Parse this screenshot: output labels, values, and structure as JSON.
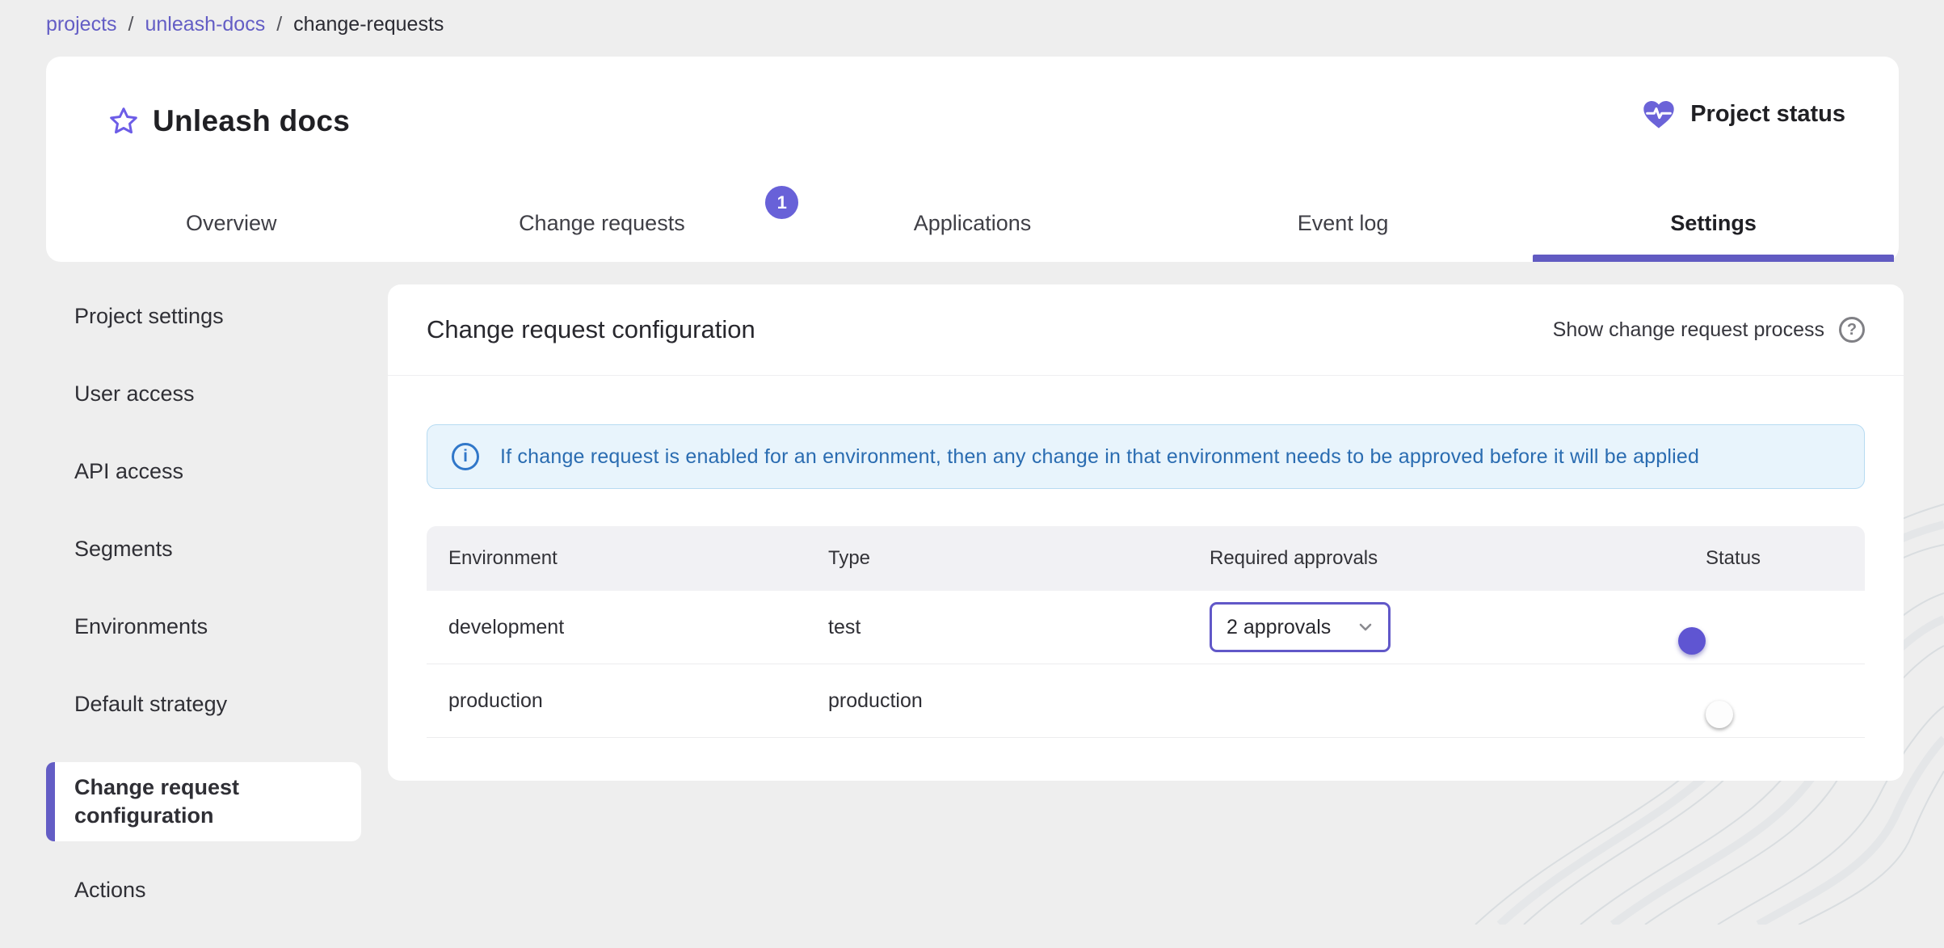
{
  "breadcrumb": {
    "separator": "/",
    "items": [
      {
        "label": "projects",
        "link": true
      },
      {
        "label": "unleash-docs",
        "link": true
      },
      {
        "label": "change-requests",
        "link": false
      }
    ]
  },
  "header": {
    "title": "Unleash docs",
    "favorite_icon": "star-outline",
    "status_label": "Project status",
    "status_icon": "heart-pulse"
  },
  "tabs": [
    {
      "label": "Overview"
    },
    {
      "label": "Change requests",
      "badge": "1"
    },
    {
      "label": "Applications"
    },
    {
      "label": "Event log"
    },
    {
      "label": "Settings",
      "active": true
    }
  ],
  "sidebar": {
    "items": [
      {
        "label": "Project settings"
      },
      {
        "label": "User access"
      },
      {
        "label": "API access"
      },
      {
        "label": "Segments"
      },
      {
        "label": "Environments"
      },
      {
        "label": "Default strategy"
      },
      {
        "label": "Change request configuration",
        "active": true
      },
      {
        "label": "Actions"
      }
    ]
  },
  "panel": {
    "title": "Change request configuration",
    "action_label": "Show change request process",
    "help_glyph": "?",
    "alert": {
      "icon_glyph": "i",
      "text": "If change request is enabled for an environment, then any change in that environment needs to be approved before it will be applied"
    },
    "table": {
      "columns": [
        "Environment",
        "Type",
        "Required approvals",
        "Status"
      ],
      "rows": [
        {
          "environment": "development",
          "type": "test",
          "required_approvals": "2 approvals",
          "status_on": true
        },
        {
          "environment": "production",
          "type": "production",
          "required_approvals": "",
          "status_on": false
        }
      ]
    }
  },
  "colors": {
    "primary": "#635dc5",
    "tab_indicator": "#615bc2",
    "badge_bg": "#6861d8",
    "toggle_on_thumb": "#5f55d2",
    "toggle_on_track": "#b2ace4",
    "toggle_off_track": "#9c9c9c",
    "alert_bg": "#e8f4fc",
    "alert_text": "#2a6cb1",
    "page_bg": "#eeeeee",
    "table_header_bg": "#f1f1f4"
  }
}
